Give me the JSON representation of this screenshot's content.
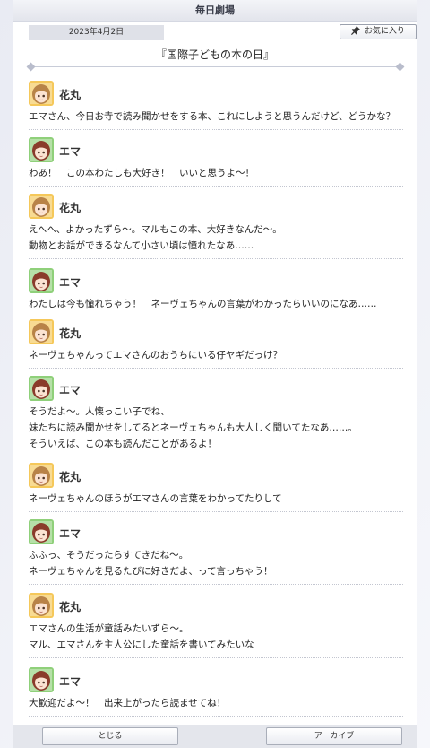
{
  "header": {
    "title": "毎日劇場"
  },
  "date": "2023年4月2日",
  "favorite_label": "お気に入り",
  "episode_title": "『国際子どもの本の日』",
  "messages": [
    {
      "speaker": "花丸",
      "avatar": "hanamaru",
      "lines": "エマさん、今日お寺で読み聞かせをする本、これにしようと思うんだけど、どうかな？"
    },
    {
      "speaker": "エマ",
      "avatar": "emma",
      "lines": "わあ！　この本わたしも大好き！　いいと思うよ～！"
    },
    {
      "speaker": "花丸",
      "avatar": "hanamaru",
      "lines": "えへへ、よかったずら～。マルもこの本、大好きなんだ～。\n動物とお話ができるなんて小さい頃は憧れたなあ……"
    },
    {
      "speaker": "エマ",
      "avatar": "emma",
      "lines": "わたしは今も憧れちゃう！　ネーヴェちゃんの言葉がわかったらいいのになあ……"
    },
    {
      "speaker": "花丸",
      "avatar": "hanamaru",
      "lines": "ネーヴェちゃんってエマさんのおうちにいる仔ヤギだっけ？"
    },
    {
      "speaker": "エマ",
      "avatar": "emma",
      "lines": "そうだよ～。人懐っこい子でね、\n妹たちに読み聞かせをしてるとネーヴェちゃんも大人しく聞いてたなあ……。\nそういえば、この本も読んだことがあるよ！"
    },
    {
      "speaker": "花丸",
      "avatar": "hanamaru",
      "lines": "ネーヴェちゃんのほうがエマさんの言葉をわかってたりして"
    },
    {
      "speaker": "エマ",
      "avatar": "emma",
      "lines": "ふふっ、そうだったらすてきだね～。\nネーヴェちゃんを見るたびに好きだよ、って言っちゃう！"
    },
    {
      "speaker": "花丸",
      "avatar": "hanamaru",
      "lines": "エマさんの生活が童話みたいずら～。\nマル、エマさんを主人公にした童話を書いてみたいな"
    },
    {
      "speaker": "エマ",
      "avatar": "emma",
      "lines": "大歓迎だよ～！　出来上がったら読ませてね！"
    }
  ],
  "footer": {
    "close_label": "とじる",
    "archive_label": "アーカイブ"
  },
  "colors": {
    "hanamaru_bg": "#f5c85a",
    "hanamaru_hair": "#b88348",
    "emma_bg": "#8fd07a",
    "emma_hair": "#8a3b2b"
  }
}
